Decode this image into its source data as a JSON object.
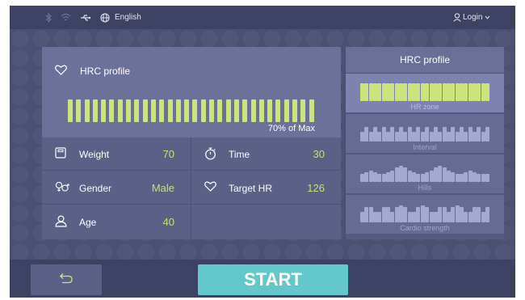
{
  "topbar": {
    "icons": [
      "bluetooth-icon",
      "wifi-icon",
      "usb-icon",
      "globe-icon",
      "user-icon",
      "chevron-down-icon"
    ],
    "language": "English",
    "login": "Login"
  },
  "main": {
    "title": "HRC profile",
    "intensity_label": "70% of Max",
    "intensity_bar_count": 30,
    "fields": {
      "weight": {
        "label": "Weight",
        "value": "70"
      },
      "time": {
        "label": "Time",
        "value": "30"
      },
      "gender": {
        "label": "Gender",
        "value": "Male"
      },
      "target_hr": {
        "label": "Target HR",
        "value": "126"
      },
      "age": {
        "label": "Age",
        "value": "40"
      }
    }
  },
  "sidebar": {
    "title": "HRC profile",
    "profiles": [
      {
        "label": "HR zone",
        "selected": true,
        "levels": [
          1,
          1,
          1,
          1,
          1,
          1,
          1,
          1,
          1,
          1,
          1,
          1,
          1,
          1,
          1,
          1,
          1,
          1,
          1,
          1,
          1,
          1,
          1,
          1,
          1,
          1,
          1,
          1,
          1,
          1
        ]
      },
      {
        "label": "Interval",
        "selected": false,
        "levels": [
          0.55,
          0.8,
          0.55,
          0.8,
          0.55,
          0.8,
          0.55,
          0.8,
          0.55,
          0.8,
          0.55,
          0.8,
          0.55,
          0.8,
          0.55,
          0.8,
          0.55,
          0.8,
          0.55,
          0.8,
          0.55,
          0.8,
          0.55,
          0.8,
          0.55,
          0.8,
          0.55,
          0.8,
          0.55,
          0.8
        ]
      },
      {
        "label": "Hills",
        "selected": false,
        "levels": [
          0.45,
          0.55,
          0.65,
          0.55,
          0.45,
          0.45,
          0.55,
          0.65,
          0.8,
          0.9,
          0.8,
          0.65,
          0.55,
          0.45,
          0.45,
          0.55,
          0.65,
          0.8,
          0.9,
          0.8,
          0.65,
          0.55,
          0.45,
          0.45,
          0.55,
          0.65,
          0.55,
          0.45,
          0.45,
          0.45
        ]
      },
      {
        "label": "Cardio strength",
        "selected": false,
        "levels": [
          0.6,
          0.85,
          0.85,
          0.6,
          0.6,
          0.85,
          0.85,
          0.6,
          0.85,
          0.95,
          0.85,
          0.6,
          0.6,
          0.85,
          0.95,
          0.85,
          0.6,
          0.6,
          0.85,
          0.85,
          0.6,
          0.85,
          0.95,
          0.85,
          0.6,
          0.6,
          0.85,
          0.85,
          0.6,
          0.85
        ]
      }
    ]
  },
  "bottom": {
    "back_icon": "back-arrow-icon",
    "start_label": "START"
  },
  "colors": {
    "accent_green": "#cde37b",
    "start_teal": "#64c7cc"
  }
}
